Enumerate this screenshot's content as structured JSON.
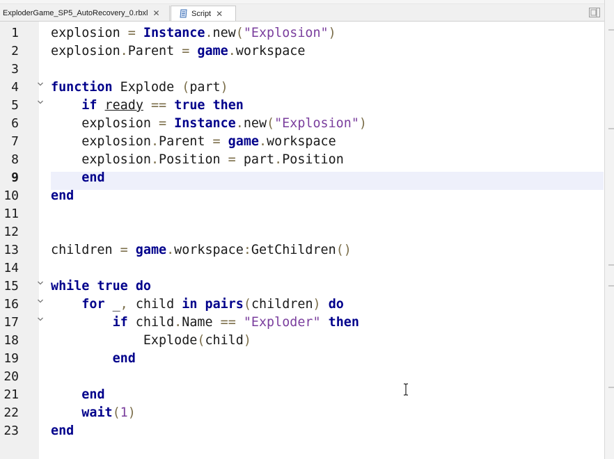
{
  "tabs": [
    {
      "label": "ExploderGame_SP5_AutoRecovery_0.rbxl",
      "active": false
    },
    {
      "label": "Script",
      "active": true
    }
  ],
  "icons": {
    "close": "close-icon",
    "script": "script-file-icon",
    "view_toggle": "split-view-icon",
    "fold": "chevron-down-icon",
    "cursor": "text-cursor-icon"
  },
  "editor": {
    "current_line": 9,
    "fold_lines": [
      4,
      5,
      15,
      16,
      17
    ],
    "colors": {
      "keyword": "#00008b",
      "string": "#7a3e9d",
      "operator": "#7b6e4a",
      "text": "#1a1a1a",
      "current_line_bg": "#eef0fb",
      "gutter_bg": "#f0f0f0"
    },
    "lines": [
      {
        "n": "1",
        "tokens": [
          [
            "explosion",
            ""
          ],
          [
            " = ",
            "op"
          ],
          [
            "Instance",
            "kw"
          ],
          [
            ".",
            "op"
          ],
          [
            "new",
            ""
          ],
          [
            "(",
            "op"
          ],
          [
            "\"Explosion\"",
            "str"
          ],
          [
            ")",
            "op"
          ]
        ]
      },
      {
        "n": "2",
        "tokens": [
          [
            "explosion",
            ""
          ],
          [
            ".",
            "op"
          ],
          [
            "Parent",
            ""
          ],
          [
            " = ",
            "op"
          ],
          [
            "game",
            "kw"
          ],
          [
            ".",
            "op"
          ],
          [
            "workspace",
            ""
          ]
        ]
      },
      {
        "n": "3",
        "tokens": []
      },
      {
        "n": "4",
        "tokens": [
          [
            "function",
            "kw"
          ],
          [
            " Explode ",
            ""
          ],
          [
            "(",
            "op"
          ],
          [
            "part",
            ""
          ],
          [
            ")",
            "op"
          ]
        ]
      },
      {
        "n": "5",
        "tokens": [
          [
            "    ",
            ""
          ],
          [
            "if",
            "kw"
          ],
          [
            " ",
            ""
          ],
          [
            "ready",
            "und"
          ],
          [
            " == ",
            "op"
          ],
          [
            "true",
            "kw"
          ],
          [
            " ",
            ""
          ],
          [
            "then",
            "kw"
          ]
        ]
      },
      {
        "n": "6",
        "tokens": [
          [
            "    explosion",
            ""
          ],
          [
            " = ",
            "op"
          ],
          [
            "Instance",
            "kw"
          ],
          [
            ".",
            "op"
          ],
          [
            "new",
            ""
          ],
          [
            "(",
            "op"
          ],
          [
            "\"Explosion\"",
            "str"
          ],
          [
            ")",
            "op"
          ]
        ]
      },
      {
        "n": "7",
        "tokens": [
          [
            "    explosion",
            ""
          ],
          [
            ".",
            "op"
          ],
          [
            "Parent",
            ""
          ],
          [
            " = ",
            "op"
          ],
          [
            "game",
            "kw"
          ],
          [
            ".",
            "op"
          ],
          [
            "workspace",
            ""
          ]
        ]
      },
      {
        "n": "8",
        "tokens": [
          [
            "    explosion",
            ""
          ],
          [
            ".",
            "op"
          ],
          [
            "Position",
            ""
          ],
          [
            " = ",
            "op"
          ],
          [
            "part",
            ""
          ],
          [
            ".",
            "op"
          ],
          [
            "Position",
            ""
          ]
        ]
      },
      {
        "n": "9",
        "tokens": [
          [
            "    ",
            ""
          ],
          [
            "end",
            "kw"
          ]
        ]
      },
      {
        "n": "10",
        "tokens": [
          [
            "end",
            "kw"
          ]
        ]
      },
      {
        "n": "11",
        "tokens": []
      },
      {
        "n": "12",
        "tokens": []
      },
      {
        "n": "13",
        "tokens": [
          [
            "children",
            ""
          ],
          [
            " = ",
            "op"
          ],
          [
            "game",
            "kw"
          ],
          [
            ".",
            "op"
          ],
          [
            "workspace",
            ""
          ],
          [
            ":",
            "op"
          ],
          [
            "GetChildren",
            ""
          ],
          [
            "()",
            "op"
          ]
        ]
      },
      {
        "n": "14",
        "tokens": []
      },
      {
        "n": "15",
        "tokens": [
          [
            "while",
            "kw"
          ],
          [
            " ",
            ""
          ],
          [
            "true",
            "kw"
          ],
          [
            " ",
            ""
          ],
          [
            "do",
            "kw"
          ]
        ]
      },
      {
        "n": "16",
        "tokens": [
          [
            "    ",
            ""
          ],
          [
            "for",
            "kw"
          ],
          [
            " _",
            ""
          ],
          [
            ",",
            "op"
          ],
          [
            " child ",
            ""
          ],
          [
            "in",
            "kw"
          ],
          [
            " ",
            ""
          ],
          [
            "pairs",
            "kw"
          ],
          [
            "(",
            "op"
          ],
          [
            "children",
            ""
          ],
          [
            ")",
            "op"
          ],
          [
            " ",
            ""
          ],
          [
            "do",
            "kw"
          ]
        ]
      },
      {
        "n": "17",
        "tokens": [
          [
            "        ",
            ""
          ],
          [
            "if",
            "kw"
          ],
          [
            " child",
            ""
          ],
          [
            ".",
            "op"
          ],
          [
            "Name",
            ""
          ],
          [
            " == ",
            "op"
          ],
          [
            "\"Exploder\"",
            "str"
          ],
          [
            " ",
            ""
          ],
          [
            "then",
            "kw"
          ]
        ]
      },
      {
        "n": "18",
        "tokens": [
          [
            "            Explode",
            ""
          ],
          [
            "(",
            "op"
          ],
          [
            "child",
            ""
          ],
          [
            ")",
            "op"
          ]
        ]
      },
      {
        "n": "19",
        "tokens": [
          [
            "        ",
            ""
          ],
          [
            "end",
            "kw"
          ]
        ]
      },
      {
        "n": "20",
        "tokens": []
      },
      {
        "n": "21",
        "tokens": [
          [
            "    ",
            ""
          ],
          [
            "end",
            "kw"
          ]
        ]
      },
      {
        "n": "22",
        "tokens": [
          [
            "    ",
            ""
          ],
          [
            "wait",
            "kw"
          ],
          [
            "(",
            "op"
          ],
          [
            "1",
            "num"
          ],
          [
            ")",
            "op"
          ]
        ]
      },
      {
        "n": "23",
        "tokens": [
          [
            "end",
            "kw"
          ]
        ]
      }
    ]
  }
}
